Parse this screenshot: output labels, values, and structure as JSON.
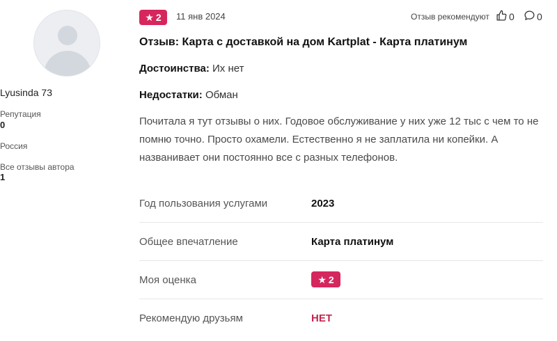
{
  "author": {
    "name": "Lyusinda 73",
    "reputation_label": "Репутация",
    "reputation_value": "0",
    "country": "Россия",
    "all_reviews_label": "Все отзывы автора",
    "all_reviews_value": "1"
  },
  "review": {
    "rating": "2",
    "date": "11 янв 2024",
    "recommend_label": "Отзыв рекомендуют",
    "likes": "0",
    "comments": "0",
    "title": "Отзыв: Карта с доставкой на дом Kartplat - Карта платинум",
    "pros_label": "Достоинства:",
    "pros_value": "Их нет",
    "cons_label": "Недостатки:",
    "cons_value": "Обман",
    "text": "Почитала я тут отзывы о них. Годовое обслуживание у них уже 12 тыс с чем то не помню точно. Просто охамели. Естественно я не заплатила ни копейки. А названивает они постоянно все с разных телефонов."
  },
  "details": {
    "year_label": "Год пользования услугами",
    "year_value": "2023",
    "impression_label": "Общее впечатление",
    "impression_value": "Карта платинум",
    "my_rating_label": "Моя оценка",
    "my_rating_value": "2",
    "recommend_label": "Рекомендую друзьям",
    "recommend_value": "НЕТ"
  },
  "colors": {
    "accent": "#d6265e",
    "no_text": "#c4254f"
  },
  "icons": {
    "rating": "star-icon",
    "like": "thumbs-up-icon",
    "comment": "comment-icon"
  }
}
